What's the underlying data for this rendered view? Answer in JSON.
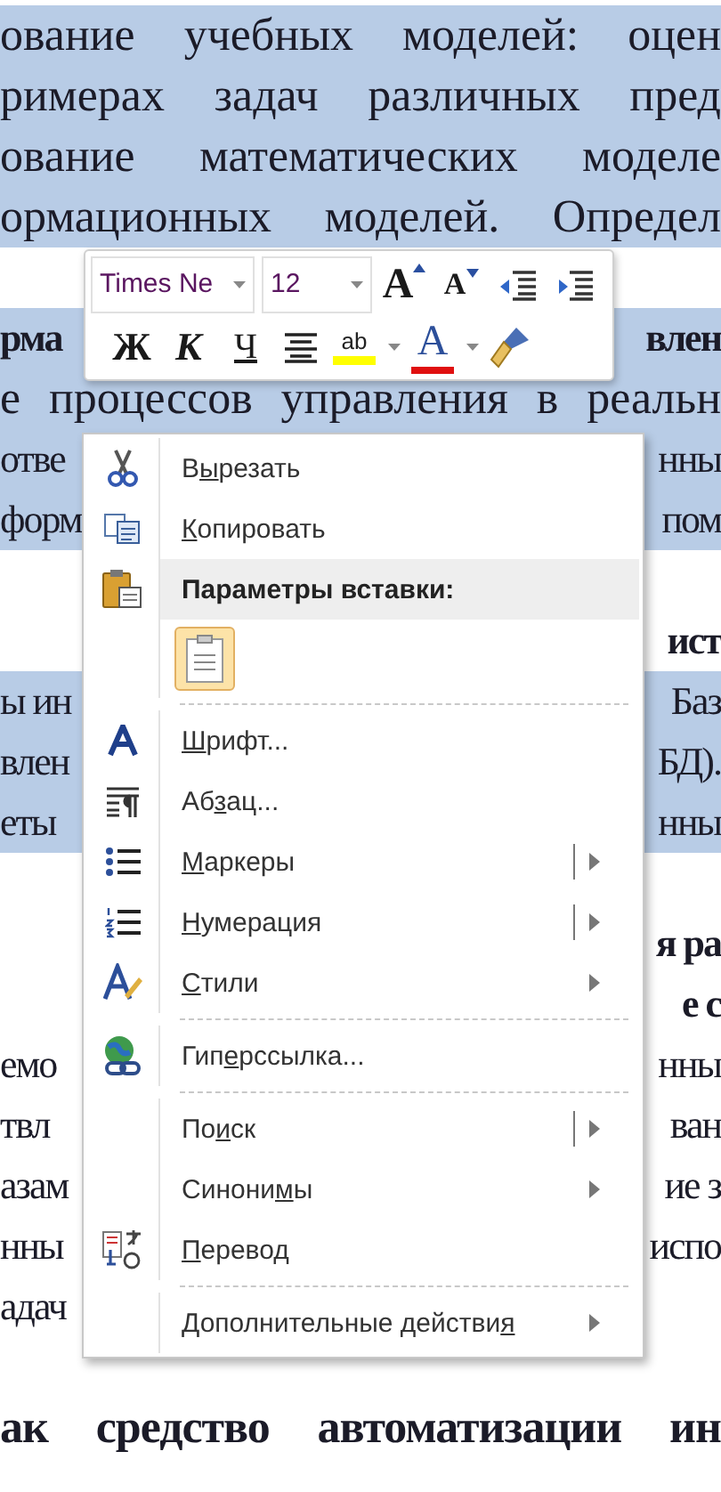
{
  "document": {
    "lines": [
      {
        "kind": "full",
        "text": "ование учебных моделей: оцен",
        "bold": false,
        "selected": true
      },
      {
        "kind": "full",
        "text": "римерах задач различных пред",
        "bold": false,
        "selected": true
      },
      {
        "kind": "full",
        "text": "ование математических моделе",
        "bold": false,
        "selected": true
      },
      {
        "kind": "full",
        "text": "ормационных моделей. Определ",
        "bold": false,
        "selected": true
      },
      {
        "kind": "blank"
      },
      {
        "kind": "split",
        "left": "рма",
        "right": "влен",
        "bold": true,
        "selected": true
      },
      {
        "kind": "full",
        "text": "е процессов управления в реальн",
        "bold": false,
        "selected": true
      },
      {
        "kind": "split",
        "left": "отве",
        "right": "нны",
        "bold": false,
        "selected": true
      },
      {
        "kind": "split",
        "left": "форм",
        "right": "пом",
        "bold": false,
        "selected": true
      },
      {
        "kind": "blank"
      },
      {
        "kind": "split",
        "right": "ист",
        "bold": true,
        "selected": false
      },
      {
        "kind": "split",
        "left": "ы ин",
        "right": "Баз",
        "bold": false,
        "selected": true
      },
      {
        "kind": "split",
        "left": "влен",
        "right": "БД).",
        "bold": false,
        "selected": true
      },
      {
        "kind": "split",
        "left": "еты",
        "right": "нны",
        "bold": false,
        "selected": true
      },
      {
        "kind": "blank"
      },
      {
        "kind": "split",
        "right": "я ра",
        "bold": true,
        "selected": false
      },
      {
        "kind": "split",
        "right": "е с",
        "bold": true,
        "selected": false
      },
      {
        "kind": "split",
        "left": "емо",
        "right": "нны",
        "bold": false,
        "selected": false
      },
      {
        "kind": "split",
        "left": "твл",
        "right": "ван",
        "bold": false,
        "selected": false
      },
      {
        "kind": "split",
        "left": "азам",
        "right": "ие з",
        "bold": false,
        "selected": false
      },
      {
        "kind": "split",
        "left": "нны",
        "right": "испо",
        "bold": false,
        "selected": false
      },
      {
        "kind": "split",
        "left": "адач",
        "bold": false,
        "selected": false
      },
      {
        "kind": "blank"
      },
      {
        "kind": "full",
        "text": "ак средство автоматизации ин",
        "bold": true,
        "selected": false
      }
    ]
  },
  "mini_toolbar": {
    "font": "Times Ne",
    "size": "12",
    "rows": [
      [
        {
          "kind": "grow",
          "label": "A"
        },
        {
          "kind": "shrink",
          "label": "A"
        },
        {
          "kind": "outdent"
        },
        {
          "kind": "indent"
        }
      ],
      [
        {
          "kind": "bold",
          "label": "Ж"
        },
        {
          "kind": "italic",
          "label": "К"
        },
        {
          "kind": "underline",
          "label": "Ч"
        },
        {
          "kind": "center"
        },
        {
          "kind": "highlight",
          "label": "ab"
        },
        {
          "kind": "caret"
        },
        {
          "kind": "color",
          "label": "A"
        },
        {
          "kind": "caret"
        },
        {
          "kind": "brush"
        }
      ]
    ]
  },
  "context_menu": {
    "items": [
      {
        "kind": "item",
        "label": {
          "before": "В",
          "key": "ы",
          "after": "резать"
        },
        "submenu": false,
        "split": false
      },
      {
        "kind": "item",
        "label": {
          "key": "К",
          "after": "опировать"
        },
        "submenu": false,
        "split": false
      },
      {
        "kind": "header",
        "text": "Параметры вставки:"
      },
      {
        "kind": "paste-options"
      },
      {
        "kind": "separator"
      },
      {
        "kind": "item",
        "label": {
          "key": "Ш",
          "after": "рифт..."
        },
        "submenu": false,
        "split": false
      },
      {
        "kind": "item",
        "label": {
          "before": "Аб",
          "key": "з",
          "after": "ац..."
        },
        "submenu": false,
        "split": false
      },
      {
        "kind": "item",
        "label": {
          "key": "М",
          "after": "аркеры"
        },
        "submenu": true,
        "split": true
      },
      {
        "kind": "item",
        "label": {
          "key": "Н",
          "after": "умерация"
        },
        "submenu": true,
        "split": true
      },
      {
        "kind": "item",
        "label": {
          "key": "С",
          "after": "тили"
        },
        "submenu": true,
        "split": false
      },
      {
        "kind": "separator"
      },
      {
        "kind": "item",
        "label": {
          "before": "Гип",
          "key": "е",
          "after": "рссылка..."
        },
        "submenu": false,
        "split": false
      },
      {
        "kind": "separator"
      },
      {
        "kind": "item",
        "label": {
          "before": "По",
          "key": "и",
          "after": "ск"
        },
        "submenu": true,
        "split": true
      },
      {
        "kind": "item",
        "label": {
          "before": "Синони",
          "key": "м",
          "after": "ы"
        },
        "submenu": true,
        "split": false
      },
      {
        "kind": "item",
        "label": {
          "key": "П",
          "after": "еревод"
        },
        "submenu": false,
        "split": false
      },
      {
        "kind": "separator"
      },
      {
        "kind": "item",
        "label": {
          "before": "Дополнительные действи",
          "key": "я"
        },
        "submenu": true,
        "split": false
      }
    ]
  }
}
